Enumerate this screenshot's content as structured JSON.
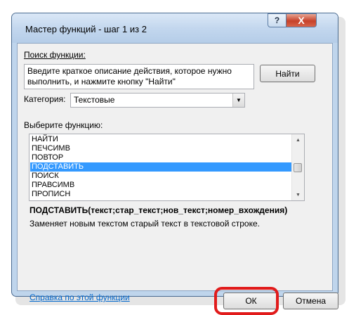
{
  "window": {
    "title": "Мастер функций - шаг 1 из 2",
    "help_glyph": "?",
    "close_glyph": "X"
  },
  "search": {
    "label": "Поиск функции:",
    "text": "Введите краткое описание действия, которое нужно выполнить, и нажмите кнопку \"Найти\"",
    "find_button": "Найти"
  },
  "category": {
    "label": "Категория:",
    "value": "Текстовые"
  },
  "functions": {
    "label": "Выберите функцию:",
    "items": [
      "НАЙТИ",
      "ПЕЧСИМВ",
      "ПОВТОР",
      "ПОДСТАВИТЬ",
      "ПОИСК",
      "ПРАВСИМВ",
      "ПРОПИСН"
    ],
    "selected_index": 3
  },
  "details": {
    "signature": "ПОДСТАВИТЬ(текст;стар_текст;нов_текст;номер_вхождения)",
    "description": "Заменяет новым текстом старый текст в текстовой строке."
  },
  "footer": {
    "help_link": "Справка по этой функции",
    "ok_button": "ОК",
    "cancel_button": "Отмена"
  },
  "colors": {
    "selection": "#3399ff",
    "highlight": "#e11b1b",
    "link": "#0066cc"
  }
}
